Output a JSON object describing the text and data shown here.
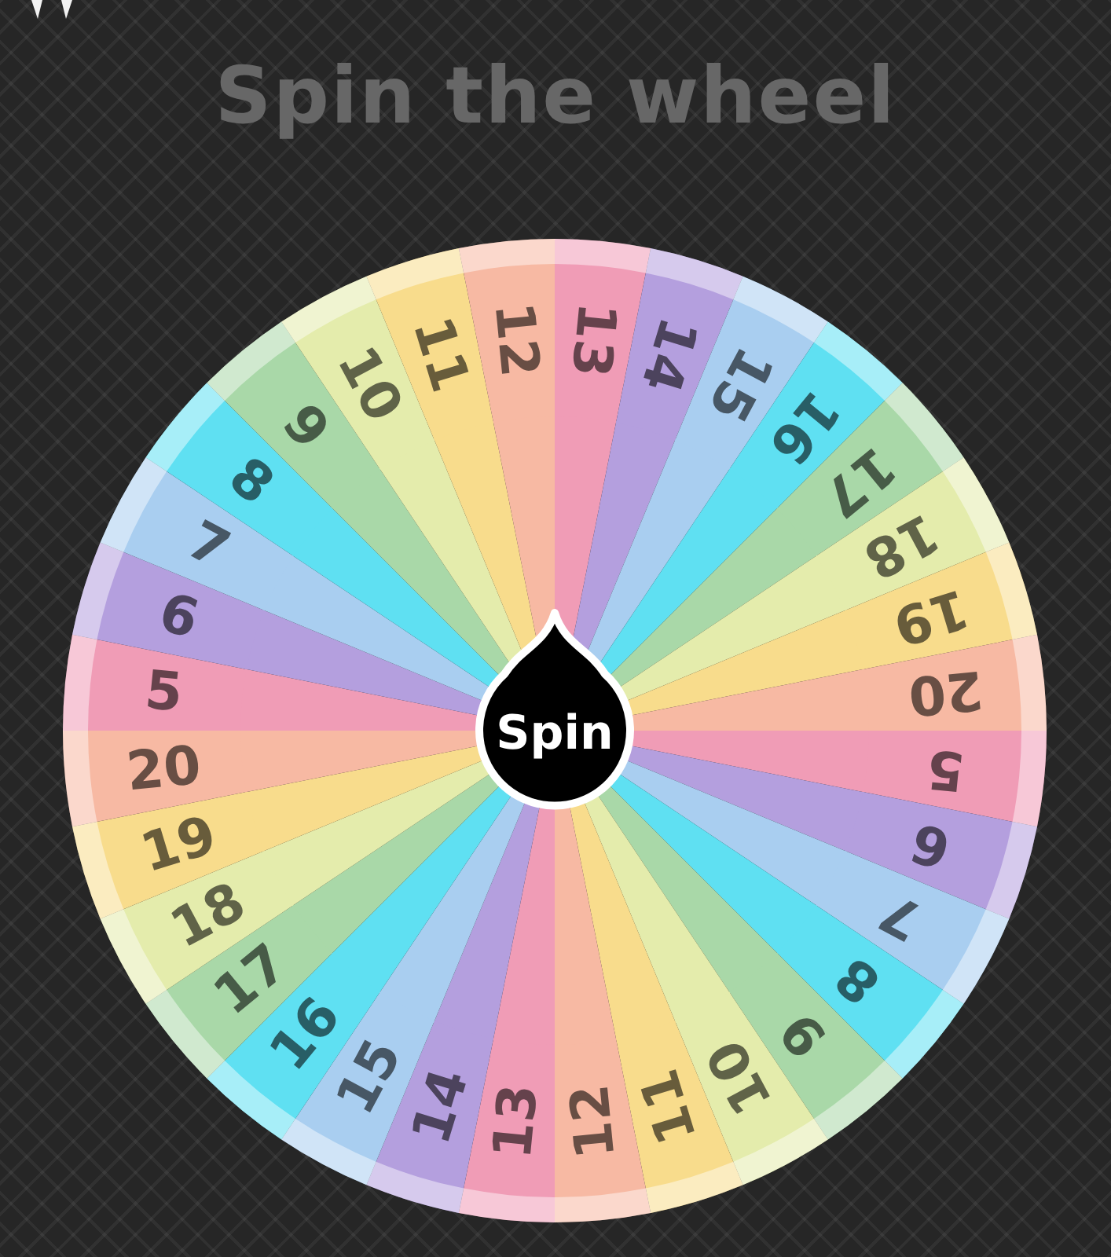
{
  "title": "Spin the wheel",
  "spin_button": {
    "label": "Spin"
  },
  "segments": [
    {
      "label": "13",
      "color": "#f09cb6"
    },
    {
      "label": "14",
      "color": "#b49fde"
    },
    {
      "label": "15",
      "color": "#a9cef0"
    },
    {
      "label": "16",
      "color": "#5fe0f2"
    },
    {
      "label": "17",
      "color": "#a9d8a8"
    },
    {
      "label": "18",
      "color": "#e4ecac"
    },
    {
      "label": "19",
      "color": "#f8dc8c"
    },
    {
      "label": "20",
      "color": "#f7b9a3"
    },
    {
      "label": "5",
      "color": "#f09cb6"
    },
    {
      "label": "6",
      "color": "#b49fde"
    },
    {
      "label": "7",
      "color": "#a9cef0"
    },
    {
      "label": "8",
      "color": "#5fe0f2"
    },
    {
      "label": "9",
      "color": "#a9d8a8"
    },
    {
      "label": "10",
      "color": "#e4ecac"
    },
    {
      "label": "11",
      "color": "#f8dc8c"
    },
    {
      "label": "12",
      "color": "#f7b9a3"
    },
    {
      "label": "13",
      "color": "#f09cb6"
    },
    {
      "label": "14",
      "color": "#b49fde"
    },
    {
      "label": "15",
      "color": "#a9cef0"
    },
    {
      "label": "16",
      "color": "#5fe0f2"
    },
    {
      "label": "17",
      "color": "#a9d8a8"
    },
    {
      "label": "18",
      "color": "#e4ecac"
    },
    {
      "label": "19",
      "color": "#f8dc8c"
    },
    {
      "label": "20",
      "color": "#f7b9a3"
    },
    {
      "label": "5",
      "color": "#f09cb6"
    },
    {
      "label": "6",
      "color": "#b49fde"
    },
    {
      "label": "7",
      "color": "#a9cef0"
    },
    {
      "label": "8",
      "color": "#5fe0f2"
    },
    {
      "label": "9",
      "color": "#a9d8a8"
    },
    {
      "label": "10",
      "color": "#e4ecac"
    },
    {
      "label": "11",
      "color": "#f8dc8c"
    },
    {
      "label": "12",
      "color": "#f7b9a3"
    }
  ]
}
